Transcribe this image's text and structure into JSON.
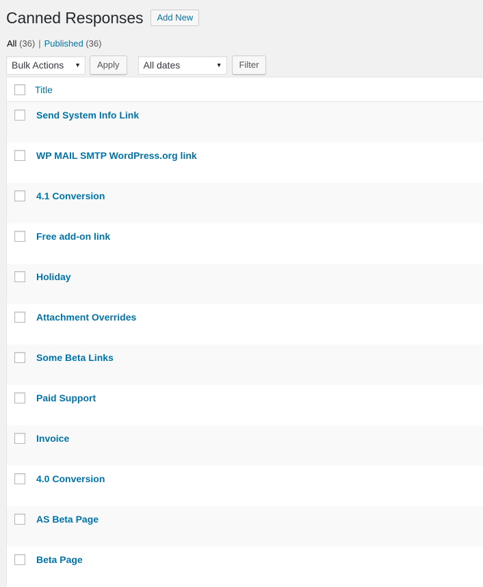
{
  "header": {
    "title": "Canned Responses",
    "add_new_label": "Add New"
  },
  "views": {
    "all_label": "All",
    "all_count": "(36)",
    "separator": "|",
    "published_label": "Published",
    "published_count": "(36)"
  },
  "tablenav": {
    "bulk_actions": {
      "selected": "Bulk Actions",
      "arrow": "▼"
    },
    "apply_label": "Apply",
    "dates": {
      "selected": "All dates",
      "arrow": "▼"
    },
    "filter_label": "Filter"
  },
  "table": {
    "columns": [
      "Title"
    ],
    "rows": [
      "Send System Info Link",
      "WP MAIL SMTP WordPress.org link",
      "4.1 Conversion",
      "Free add-on link",
      "Holiday",
      "Attachment Overrides",
      "Some Beta Links",
      "Paid Support",
      "Invoice",
      "4.0 Conversion",
      "AS Beta Page",
      "Beta Page"
    ]
  },
  "colors": {
    "link": "#0073aa",
    "background": "#f1f1f1",
    "row_alt": "#f9f9f9"
  }
}
